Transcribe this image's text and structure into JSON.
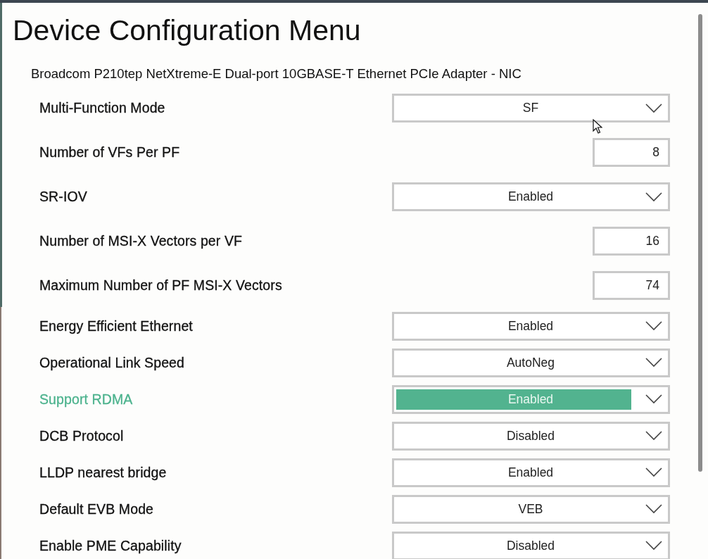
{
  "title": "Device Configuration Menu",
  "device": "Broadcom P210tep NetXtreme-E Dual-port 10GBASE-T Ethernet PCIe Adapter - NIC",
  "settings": [
    {
      "label": "Multi-Function Mode",
      "kind": "dropdown",
      "value": "SF",
      "selected": false
    },
    {
      "label": "Number of VFs Per PF",
      "kind": "number",
      "value": "8",
      "selected": false
    },
    {
      "label": "SR-IOV",
      "kind": "dropdown",
      "value": "Enabled",
      "selected": false
    },
    {
      "label": "Number of MSI-X Vectors per VF",
      "kind": "number",
      "value": "16",
      "selected": false
    },
    {
      "label": "Maximum Number of PF MSI-X Vectors",
      "kind": "number",
      "value": "74",
      "selected": false
    },
    {
      "label": "Energy Efficient Ethernet",
      "kind": "dropdown",
      "value": "Enabled",
      "selected": false
    },
    {
      "label": "Operational Link Speed",
      "kind": "dropdown",
      "value": "AutoNeg",
      "selected": false
    },
    {
      "label": "Support RDMA",
      "kind": "dropdown",
      "value": "Enabled",
      "selected": true
    },
    {
      "label": "DCB Protocol",
      "kind": "dropdown",
      "value": "Disabled",
      "selected": false
    },
    {
      "label": "LLDP nearest bridge",
      "kind": "dropdown",
      "value": "Enabled",
      "selected": false
    },
    {
      "label": "Default EVB Mode",
      "kind": "dropdown",
      "value": "VEB",
      "selected": false
    },
    {
      "label": "Enable PME Capability",
      "kind": "dropdown",
      "value": "Disabled",
      "selected": false
    }
  ]
}
